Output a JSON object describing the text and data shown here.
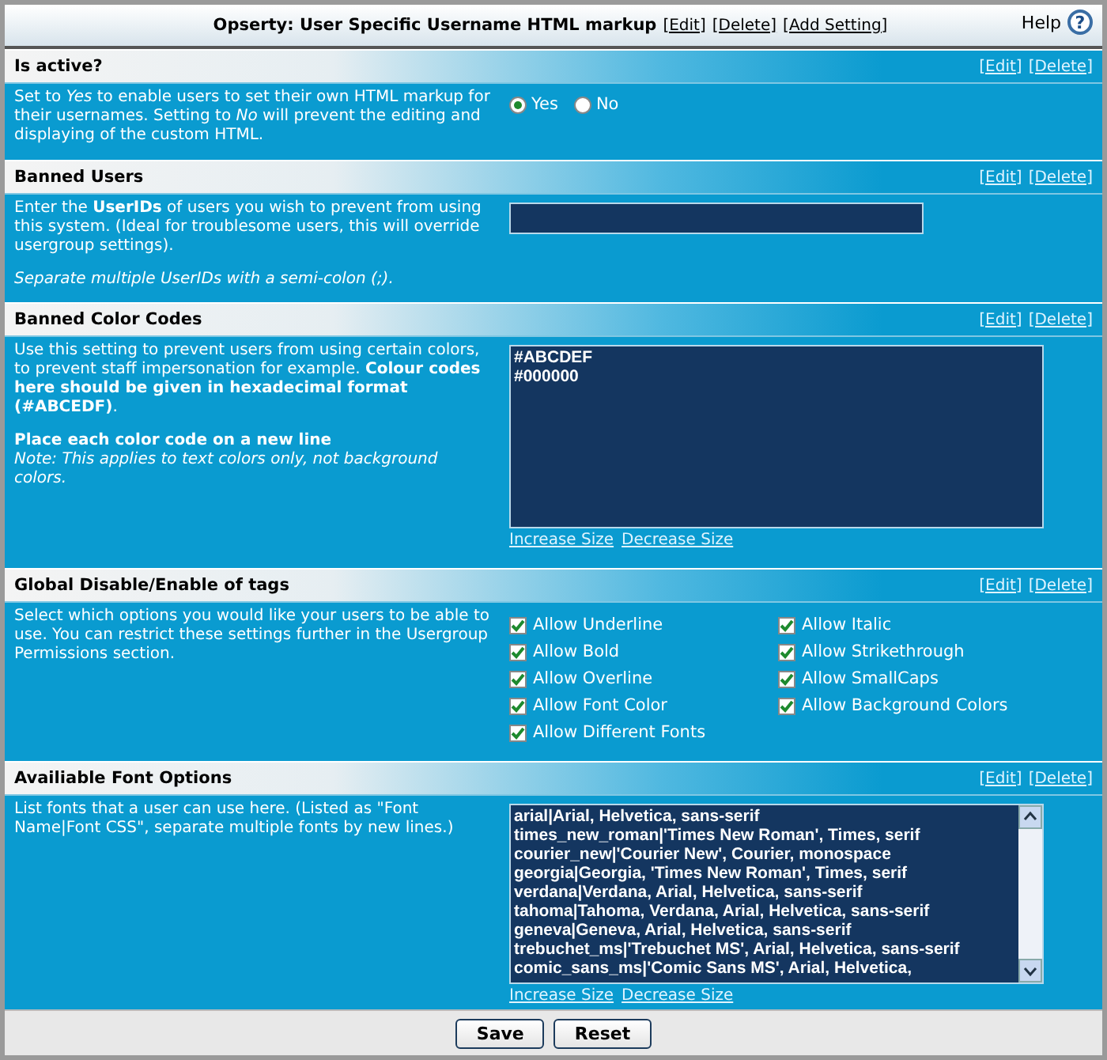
{
  "window": {
    "title": "Opserty: User Specific Username HTML markup",
    "title_links": [
      "[Edit]",
      "[Delete]",
      "[Add Setting]"
    ],
    "help": "Help",
    "help_icon": "?"
  },
  "sections": [
    {
      "kind": "radio",
      "title": "Is active?",
      "links": [
        "[Edit]",
        "[Delete]"
      ],
      "description": [
        "Set to *Yes* to enable users to set their own HTML markup for their usernames. Setting to *No* will prevent the editing and displaying of the custom HTML."
      ],
      "options": [
        {
          "label": "Yes",
          "selected": true
        },
        {
          "label": "No",
          "selected": false
        }
      ]
    },
    {
      "kind": "text",
      "title": "Banned Users",
      "links": [
        "[Edit]",
        "[Delete]"
      ],
      "description": [
        "Enter the **UserIDs** of users you wish to prevent from using this system. (Ideal for troublesome users, this will override usergroup settings).",
        "*Separate multiple UserIDs with a semi-colon (;).*"
      ]
    },
    {
      "kind": "textarea",
      "title": "Banned Color Codes",
      "links": [
        "[Edit]",
        "[Delete]"
      ],
      "description": [
        "Use this setting to prevent users from using certain colors, to prevent staff impersonation for example. **Colour codes here should be given in hexadecimal format (#ABCEDF)**.",
        "**Place each color code on a new line**\n*Note: This applies to text colors only, not background colors.*"
      ],
      "lines": [
        "#ABCDEF",
        "#000000"
      ],
      "scrollbar": false,
      "size_links": [
        "Increase Size",
        "Decrease Size"
      ]
    },
    {
      "kind": "checkboxes",
      "title": "Global Disable/Enable of tags",
      "links": [
        "[Edit]",
        "[Delete]"
      ],
      "description": [
        "Select which options you would like your users to be able to use. You can restrict these settings further in the Usergroup Permissions section."
      ],
      "options": [
        {
          "label": "Allow Underline",
          "checked": true
        },
        {
          "label": "Allow Italic",
          "checked": true
        },
        {
          "label": "Allow Bold",
          "checked": true
        },
        {
          "label": "Allow Strikethrough",
          "checked": true
        },
        {
          "label": "Allow Overline",
          "checked": true
        },
        {
          "label": "Allow SmallCaps",
          "checked": true
        },
        {
          "label": "Allow Font Color",
          "checked": true
        },
        {
          "label": "Allow Background Colors",
          "checked": true
        },
        {
          "label": "Allow Different Fonts",
          "checked": true
        }
      ]
    },
    {
      "kind": "textarea",
      "title": "Availiable Font Options",
      "links": [
        "[Edit]",
        "[Delete]"
      ],
      "description": [
        "List fonts that a user can use here. (Listed as \"Font Name|Font CSS\", separate multiple fonts by new lines.)"
      ],
      "lines": [
        "arial|Arial, Helvetica, sans-serif",
        "times_new_roman|'Times New Roman', Times, serif",
        "courier_new|'Courier New', Courier, monospace",
        "georgia|Georgia, 'Times New Roman', Times, serif",
        "verdana|Verdana, Arial, Helvetica, sans-serif",
        "tahoma|Tahoma, Verdana, Arial, Helvetica, sans-serif",
        "geneva|Geneva, Arial, Helvetica, sans-serif",
        "trebuchet_ms|'Trebuchet MS', Arial, Helvetica, sans-serif",
        "comic_sans_ms|'Comic Sans MS', Arial, Helvetica,"
      ],
      "scrollbar": true,
      "size_links": [
        "Increase Size",
        "Decrease Size"
      ]
    }
  ],
  "buttons": [
    "Save",
    "Reset"
  ]
}
